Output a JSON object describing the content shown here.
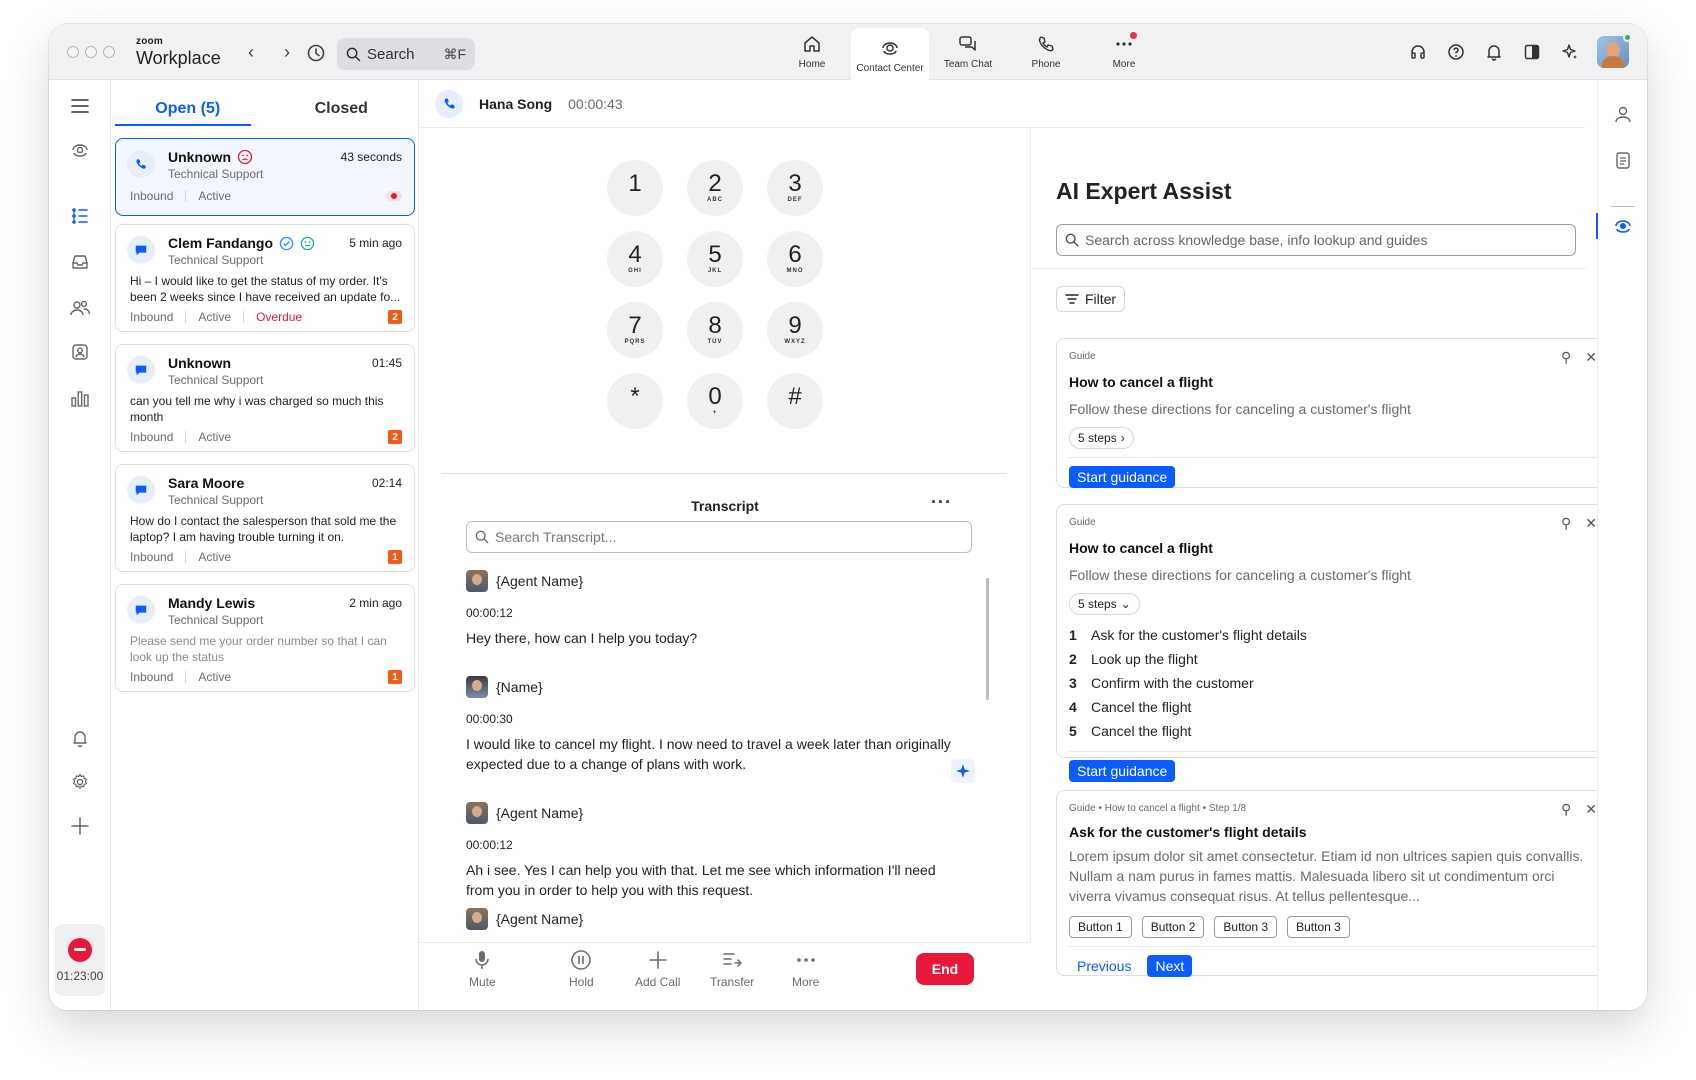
{
  "app": {
    "brand_small": "zoom",
    "brand_big": "Workplace",
    "search_placeholder": "Search",
    "search_shortcut": "⌘F",
    "nav": [
      {
        "label": "Home",
        "icon": "home-icon"
      },
      {
        "label": "Contact Center",
        "icon": "contact-center-icon",
        "active": true
      },
      {
        "label": "Team Chat",
        "icon": "team-chat-icon"
      },
      {
        "label": "Phone",
        "icon": "phone-icon"
      },
      {
        "label": "More",
        "icon": "more-icon",
        "notification": true
      }
    ]
  },
  "rail": {
    "timer": "01:23:00"
  },
  "conversations": {
    "tabs": [
      {
        "label": "Open (5)",
        "active": true
      },
      {
        "label": "Closed",
        "active": false
      }
    ],
    "items": [
      {
        "name": "Unknown",
        "time": "43 seconds",
        "dept": "Technical Support",
        "message": "",
        "direction": "Inbound",
        "status": "Active",
        "channel": "voice",
        "sentiment": "negative-face-icon"
      },
      {
        "name": "Clem Fandango",
        "time": "5 min ago",
        "dept": "Technical Support",
        "message": "Hi – I would like to get the status of my order. It's been 2 weeks since I have received an update fo...",
        "direction": "Inbound",
        "status": "Active",
        "overdue": "Overdue",
        "badge": "2",
        "channel": "chat"
      },
      {
        "name": "Unknown",
        "time": "01:45",
        "dept": "Technical Support",
        "message": "can you tell me why i was charged so much this month",
        "direction": "Inbound",
        "status": "Active",
        "badge": "2",
        "channel": "chat"
      },
      {
        "name": "Sara Moore",
        "time": "02:14",
        "dept": "Technical Support",
        "message": "How do I contact the salesperson that sold me the laptop? I am having trouble turning it on.",
        "direction": "Inbound",
        "status": "Active",
        "badge": "1",
        "channel": "chat"
      },
      {
        "name": "Mandy Lewis",
        "time": "2 min ago",
        "dept": "Technical Support",
        "message": "Please send me your order number so that I can look up the status",
        "direction": "Inbound",
        "status": "Active",
        "badge": "1",
        "channel": "chat"
      }
    ]
  },
  "call": {
    "caller": "Hana Song",
    "duration": "00:00:43",
    "keys": [
      {
        "d": "1",
        "l": ""
      },
      {
        "d": "2",
        "l": "ABC"
      },
      {
        "d": "3",
        "l": "DEF"
      },
      {
        "d": "4",
        "l": "GHI"
      },
      {
        "d": "5",
        "l": "JKL"
      },
      {
        "d": "6",
        "l": "MNO"
      },
      {
        "d": "7",
        "l": "PQRS"
      },
      {
        "d": "8",
        "l": "TUV"
      },
      {
        "d": "9",
        "l": "WXYZ"
      },
      {
        "d": "*",
        "l": ""
      },
      {
        "d": "0",
        "l": "+"
      },
      {
        "d": "#",
        "l": ""
      }
    ],
    "transcript_title": "Transcript",
    "transcript_search_placeholder": "Search Transcript...",
    "messages": [
      {
        "who": "{Agent Name}",
        "ts": "00:00:12",
        "text": "Hey there, how can I help you today?"
      },
      {
        "who": "{Name}",
        "ts": "00:00:30",
        "text": "I would like to cancel my flight. I now need to travel a week later than originally expected due to a change of plans with work."
      },
      {
        "who": "{Agent Name}",
        "ts": "00:00:12",
        "text": "Ah i see. Yes I can help you with that. Let me see which information I'll need from you in order to help you with this request."
      },
      {
        "who": "{Agent Name}",
        "ts": "",
        "text": ""
      }
    ],
    "controls": {
      "mute": "Mute",
      "hold": "Hold",
      "add_call": "Add Call",
      "transfer": "Transfer",
      "more": "More",
      "end": "End"
    }
  },
  "ai": {
    "title": "AI Expert Assist",
    "search_placeholder": "Search across knowledge base, info lookup and guides",
    "filter": "Filter",
    "cards": [
      {
        "eyebrow": "Guide",
        "title": "How to cancel a flight",
        "desc": "Follow these directions for canceling a customer's flight",
        "steps": "5 steps",
        "button": "Start guidance"
      },
      {
        "eyebrow": "Guide",
        "title": "How to cancel a flight",
        "desc": "Follow these directions for canceling a customer's flight",
        "steps": "5 steps",
        "list": [
          "Ask for the customer's flight details",
          "Look up the flight",
          "Confirm with the customer",
          "Cancel the flight",
          "Cancel the flight"
        ],
        "button": "Start guidance"
      },
      {
        "eyebrow": "Guide • How to cancel a flight • Step 1/8",
        "title": "Ask for the customer's flight details",
        "desc": "Lorem ipsum dolor sit amet consectetur. Etiam id non ultrices sapien quis convallis. Nullam a nam purus in fames mattis. Malesuada libero sit ut condimentum orci viverra vivamus consequat risus. At tellus pellentesque...",
        "buttons": [
          "Button 1",
          "Button 2",
          "Button 3",
          "Button 3"
        ],
        "prev": "Previous",
        "next": "Next"
      }
    ]
  },
  "colors": {
    "accent": "#0b5cff",
    "danger": "#e8183a",
    "badge": "#f25a18"
  }
}
